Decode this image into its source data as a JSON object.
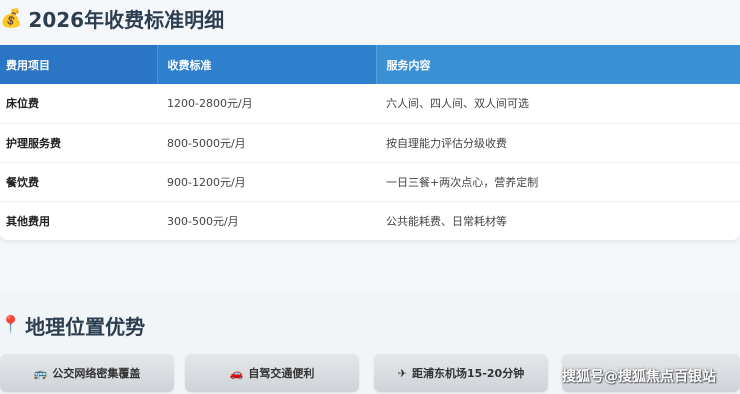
{
  "fees": {
    "heading_icon": "money-bag-icon",
    "heading": "2026年收费标准明细",
    "columns": [
      "费用项目",
      "收费标准",
      "服务内容"
    ],
    "rows": [
      {
        "item": "床位费",
        "price": "1200-2800元/月",
        "content": "六人间、四人间、双人间可选"
      },
      {
        "item": "护理服务费",
        "price": "800-5000元/月",
        "content": "按自理能力评估分级收费"
      },
      {
        "item": "餐饮费",
        "price": "900-1200元/月",
        "content": "一日三餐+两次点心，营养定制"
      },
      {
        "item": "其他费用",
        "price": "300-500元/月",
        "content": "公共能耗费、日常耗材等"
      }
    ]
  },
  "location": {
    "heading_icon": "pushpin-icon",
    "heading": "地理位置优势",
    "chips": [
      {
        "icon": "bus-icon",
        "label": "公交网络密集覆盖"
      },
      {
        "icon": "car-icon",
        "label": "自驾交通便利"
      },
      {
        "icon": "airplane-icon",
        "label": "距浦东机场15-20分钟"
      },
      {
        "icon": "",
        "label": ""
      }
    ]
  },
  "watermark": "搜狐号@搜狐焦点百银站"
}
